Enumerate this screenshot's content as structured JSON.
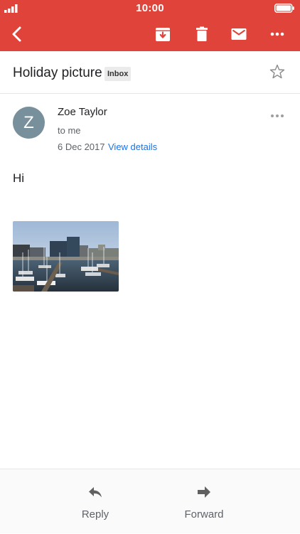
{
  "status_bar": {
    "time": "10:00"
  },
  "app_bar": {
    "icons": [
      "back-arrow-icon",
      "archive-icon",
      "delete-icon",
      "mark-unread-icon",
      "more-icon"
    ],
    "color": "#e0433a"
  },
  "email": {
    "subject": "Holiday picture",
    "label": "Inbox",
    "sender_initial": "Z",
    "sender_name": "Zoe Taylor",
    "recipient": "to me",
    "date": "6 Dec 2017",
    "view_details": "View details",
    "body": "Hi"
  },
  "actions": {
    "reply_label": "Reply",
    "forward_label": "Forward"
  },
  "colors": {
    "accent": "#e0433a",
    "link": "#1a73e8",
    "avatar": "#78909c"
  }
}
